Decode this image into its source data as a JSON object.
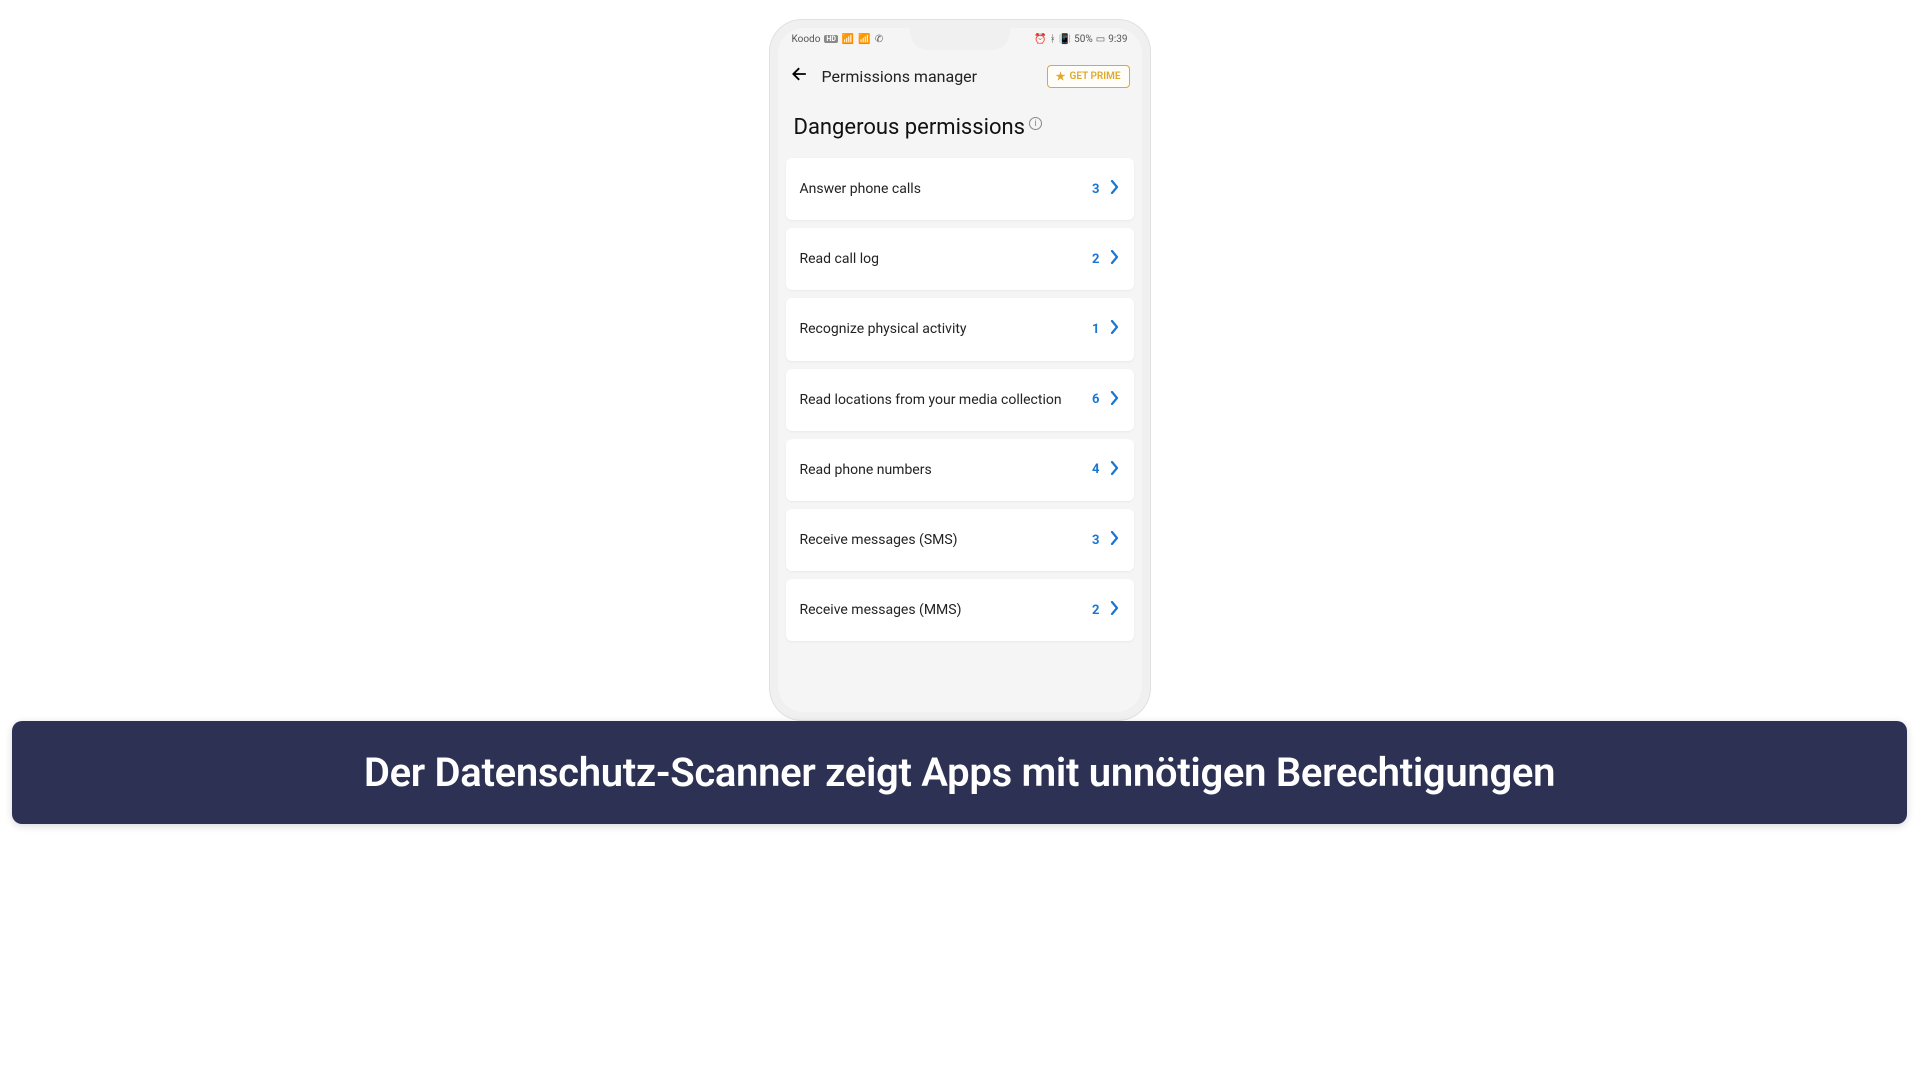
{
  "status_bar": {
    "carrier": "Koodo",
    "carrier_badge": "HD",
    "battery_pct": "50%",
    "time": "9:39"
  },
  "header": {
    "title": "Permissions manager",
    "prime_label": "GET PRIME"
  },
  "section": {
    "title": "Dangerous permissions"
  },
  "permissions": [
    {
      "label": "Answer phone calls",
      "count": "3"
    },
    {
      "label": "Read call log",
      "count": "2"
    },
    {
      "label": "Recognize physical activity",
      "count": "1"
    },
    {
      "label": "Read locations from your media collection",
      "count": "6"
    },
    {
      "label": "Read phone numbers",
      "count": "4"
    },
    {
      "label": "Receive messages (SMS)",
      "count": "3"
    },
    {
      "label": "Receive messages (MMS)",
      "count": "2"
    }
  ],
  "caption": "Der Datenschutz-Scanner zeigt Apps mit unnötigen Berechtigungen"
}
